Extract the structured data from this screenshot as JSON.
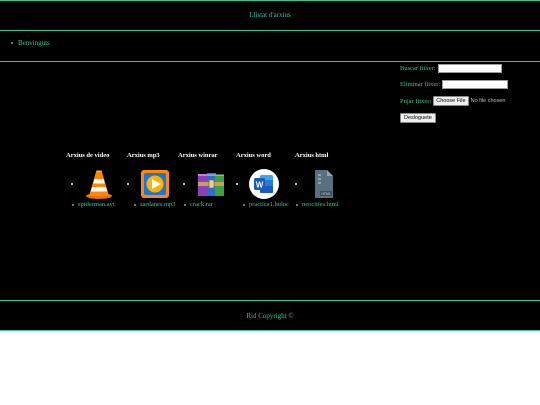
{
  "header": {
    "title": "Llistat d'arxius"
  },
  "nav": {
    "items": [
      {
        "label": "Benvinguts"
      }
    ]
  },
  "forms": {
    "search_label": "Buscar fitxer:",
    "delete_label": "Eliminar fitxer:",
    "upload_label": "Pujar fitxer:",
    "choose_file_label": "Choose File",
    "file_status": "No file chosen",
    "logout_label": "Desloguete"
  },
  "columns": [
    {
      "heading": "Arxius de video",
      "icon": "vlc-cone-icon",
      "file": "spiderman.avi"
    },
    {
      "heading": "Arxius mp3",
      "icon": "media-player-icon",
      "file": "sardanes.mp3"
    },
    {
      "heading": "Arxius winrar",
      "icon": "winrar-archive-icon",
      "file": "crack.rar"
    },
    {
      "heading": "Arxius word",
      "icon": "word-document-icon",
      "file": "practica1.htdoc"
    },
    {
      "heading": "Arxius html",
      "icon": "html-file-icon",
      "file": "neocities.html"
    }
  ],
  "footer": {
    "copyright": "Rid Copyright ©"
  },
  "colors": {
    "accent": "#2fc79b",
    "background": "#000000"
  }
}
